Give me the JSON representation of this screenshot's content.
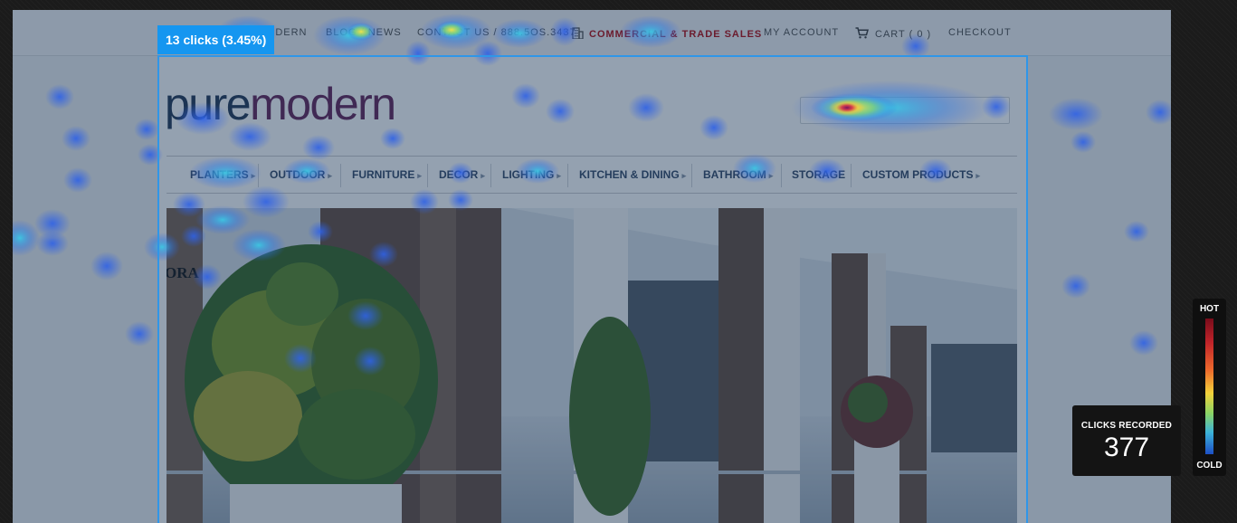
{
  "topnav": {
    "home": "PURE MODERN",
    "blog": "BLOG / NEWS",
    "contact": "CONTACT US / 888.5OS.3437",
    "commercial_prefix": "COMMERCIAL & ",
    "commercial_red": "TRADE SALES",
    "account": "MY ACCOUNT",
    "cart": "CART ( 0 )",
    "checkout": "CHECKOUT"
  },
  "logo": {
    "part1": "pure",
    "part2": "modern"
  },
  "mainnav": [
    {
      "label": "PLANTERS"
    },
    {
      "label": "OUTDOOR"
    },
    {
      "label": "FURNITURE"
    },
    {
      "label": "DECOR"
    },
    {
      "label": "LIGHTING"
    },
    {
      "label": "KITCHEN & DINING"
    },
    {
      "label": "BATHROOM"
    },
    {
      "label": "STORAGE"
    },
    {
      "label": "CUSTOM PRODUCTS"
    }
  ],
  "hero_sign_text": "ORA",
  "selection": {
    "clicks_label": "13 clicks (3.45%)"
  },
  "stats": {
    "label": "CLICKS RECORDED",
    "value": "377"
  },
  "legend": {
    "hot": "HOT",
    "cold": "COLD"
  },
  "colors": {
    "overlay": "#08264a",
    "selection_border": "#2f96e8",
    "tag_bg": "#1596f0",
    "logo_pure": "#2b3f5b",
    "logo_modern": "#6a2c5c",
    "trade_sales_red": "#b4151b"
  },
  "icons": [
    "building-icon",
    "cart-icon",
    "caret-icon"
  ]
}
